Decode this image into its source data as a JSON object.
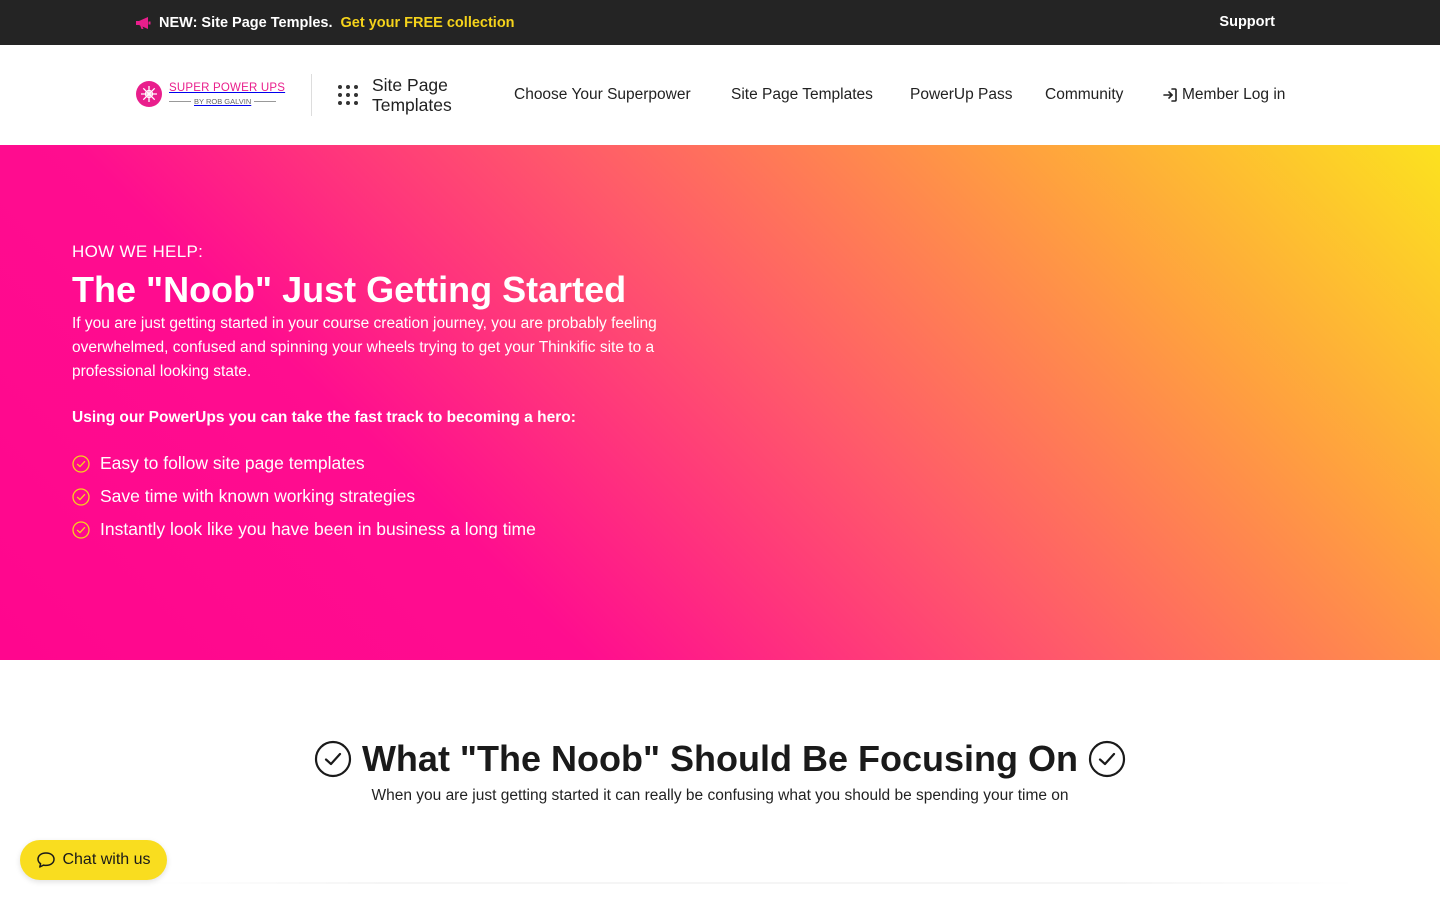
{
  "announcement": {
    "text": "NEW: Site Page Temples.",
    "link_text": "Get your FREE collection",
    "support_label": "Support",
    "link_color": "#f5d31b",
    "icon": "megaphone-icon"
  },
  "header": {
    "logo": {
      "brand": "SUPER POWER UPS",
      "byline": "BY ROB GALVIN",
      "icon": "starburst-logo-icon"
    },
    "apps_icon": "apps-grid-icon",
    "site_title": "Site Page Templates",
    "nav": [
      {
        "label": "Choose Your Superpower"
      },
      {
        "label": "Site Page Templates"
      },
      {
        "label": "PowerUp Pass"
      },
      {
        "label": "Community"
      }
    ],
    "login": {
      "label": "Member Log in",
      "icon": "log-in-icon"
    }
  },
  "hero": {
    "eyebrow": "HOW WE HELP:",
    "title": "The \"Noob\" Just Getting Started",
    "lead": "If you are just getting started in your course creation journey, you are probably feeling overwhelmed, confused and spinning your wheels trying to get your Thinkific site to a professional looking state.",
    "strong_lead": "Using our PowerUps you can take the fast track to becoming a hero:",
    "bullets": [
      {
        "text": "Easy to follow site page templates"
      },
      {
        "text": "Save time with known working strategies"
      },
      {
        "text": "Instantly look like you have been in business a long time"
      }
    ],
    "bullet_icon": "check-circle-icon",
    "gradient": [
      "#ff068e",
      "#ff5a6a",
      "#ffa03f",
      "#fce21f"
    ]
  },
  "focus": {
    "title": "What \"The Noob\" Should Be Focusing On",
    "subtitle": "When you are just getting started it can really be confusing what you should be spending your time on",
    "icon": "check-circle-icon"
  },
  "chat": {
    "label": "Chat with us",
    "icon": "chat-bubble-icon",
    "color": "#f9dd1f"
  }
}
